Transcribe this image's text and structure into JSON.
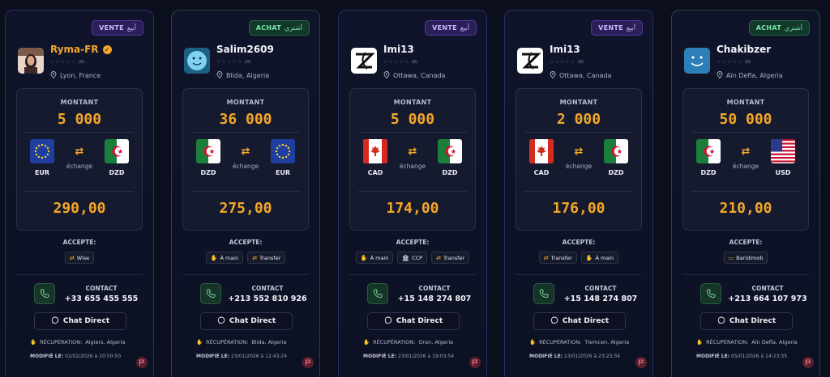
{
  "labels": {
    "montant": "MONTANT",
    "echange": "échange",
    "accepte": "ACCEPTE:",
    "contact": "CONTACT",
    "chat_direct": "Chat Direct",
    "recuperation": "RÉCUPÉRATION:",
    "modifie": "MODIFIÉ LE:"
  },
  "cards": [
    {
      "badge": "VENTE",
      "badge_ar": "أبيع",
      "badge_kind": "sell",
      "username": "Ryma-FR",
      "verified": true,
      "rating_count": "(0)",
      "location": "Lyon, France",
      "amount": "5 000",
      "from_code": "EUR",
      "to_code": "DZD",
      "rate": "290,00",
      "methods": [
        {
          "icon": "wise-icon",
          "label": "Wise"
        }
      ],
      "phone": "+33 655 455 555",
      "recup_city": "Algiers, Algeria",
      "modified": "02/02/2026 à 10:50:50"
    },
    {
      "badge": "ACHAT",
      "badge_ar": "أشتري",
      "badge_kind": "buy",
      "username": "Salim2609",
      "verified": false,
      "rating_count": "(0)",
      "location": "Blida, Algeria",
      "amount": "36 000",
      "from_code": "DZD",
      "to_code": "EUR",
      "rate": "275,00",
      "methods": [
        {
          "icon": "hand-icon",
          "label": "À main"
        },
        {
          "icon": "transfer-icon",
          "label": "Transfer"
        }
      ],
      "phone": "+213 552 810 926",
      "recup_city": "Blida, Algeria",
      "modified": "23/01/2026 à 12:43:24"
    },
    {
      "badge": "VENTE",
      "badge_ar": "أبيع",
      "badge_kind": "sell",
      "username": "Imi13",
      "verified": false,
      "rating_count": "(0)",
      "location": "Ottawa, Canada",
      "amount": "5 000",
      "from_code": "CAD",
      "to_code": "DZD",
      "rate": "174,00",
      "methods": [
        {
          "icon": "hand-icon",
          "label": "À main"
        },
        {
          "icon": "bank-icon",
          "label": "CCP"
        },
        {
          "icon": "transfer-icon",
          "label": "Transfer"
        }
      ],
      "phone": "+15 148 274 807",
      "recup_city": "Oran, Algeria",
      "modified": "23/01/2026 à 19:03:54"
    },
    {
      "badge": "VENTE",
      "badge_ar": "أبيع",
      "badge_kind": "sell",
      "username": "Imi13",
      "verified": false,
      "rating_count": "(0)",
      "location": "Ottawa, Canada",
      "amount": "2 000",
      "from_code": "CAD",
      "to_code": "DZD",
      "rate": "176,00",
      "methods": [
        {
          "icon": "transfer-icon",
          "label": "Transfer"
        },
        {
          "icon": "hand-icon",
          "label": "À main"
        }
      ],
      "phone": "+15 148 274 807",
      "recup_city": "Tlemcen, Algeria",
      "modified": "23/01/2026 à 23:23:34"
    },
    {
      "badge": "ACHAT",
      "badge_ar": "أشتري",
      "badge_kind": "buy",
      "username": "Chakibzer",
      "verified": false,
      "rating_count": "(0)",
      "location": "Aïn Defla, Algeria",
      "amount": "50 000",
      "from_code": "DZD",
      "to_code": "USD",
      "rate": "210,00",
      "methods": [
        {
          "icon": "card-icon",
          "label": "Baridimob"
        }
      ],
      "phone": "+213 664 107 973",
      "recup_city": "Aïn Defla, Algeria",
      "modified": "05/01/2026 à 14:23:35"
    }
  ],
  "colors": {
    "accent": "#f4a629",
    "sell_badge": "#2c1f57",
    "buy_badge": "#12382a",
    "page_bg": "#0b0f1d"
  }
}
